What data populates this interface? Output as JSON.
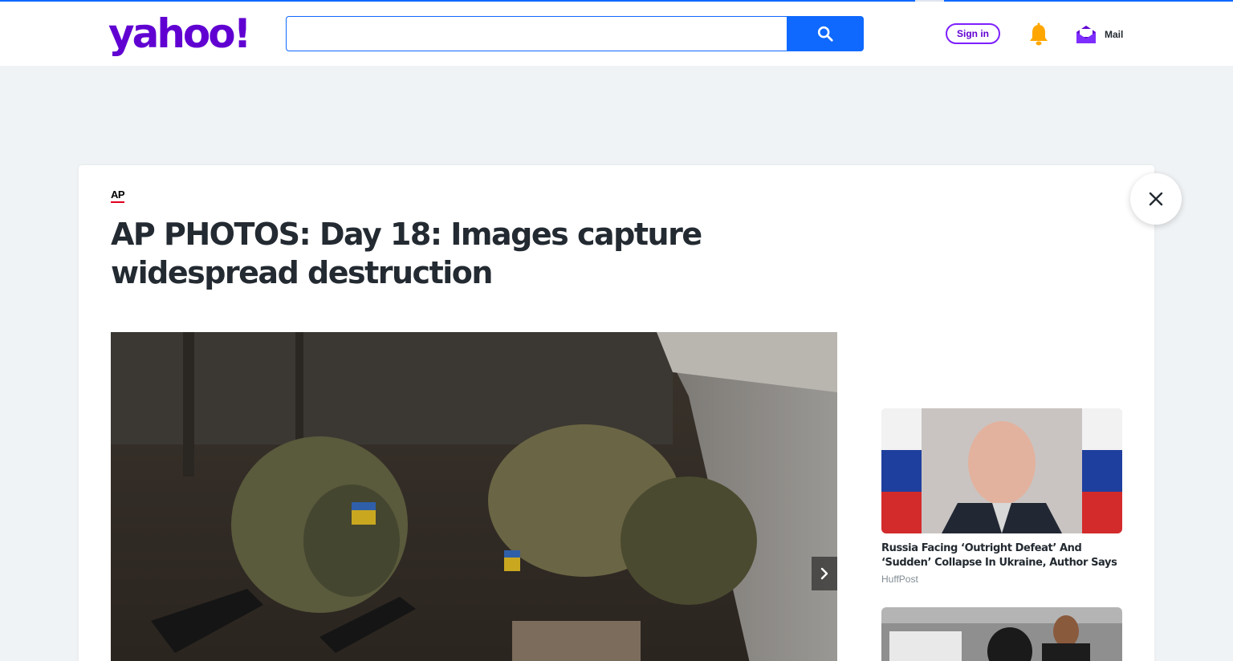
{
  "header": {
    "logo_text": "yahoo!",
    "search": {
      "value": "",
      "placeholder": ""
    },
    "signin_label": "Sign in",
    "mail_label": "Mail"
  },
  "article": {
    "source": "AP",
    "title": "AP PHOTOS: Day 18: Images capture widespread destruction"
  },
  "sidebar": {
    "items": [
      {
        "title": "Russia Facing ‘Outright Defeat’ And ‘Sudden’ Collapse In Ukraine, Author Says",
        "source": "HuffPost"
      }
    ]
  },
  "colors": {
    "brand": "#6001d2",
    "accent": "#0f69ff",
    "text": "#232a31",
    "muted": "#828c93",
    "page_bg": "#f0f3f5"
  },
  "icons": [
    "search-icon",
    "bell-icon",
    "mail-icon",
    "close-icon",
    "chevron-right-icon"
  ]
}
